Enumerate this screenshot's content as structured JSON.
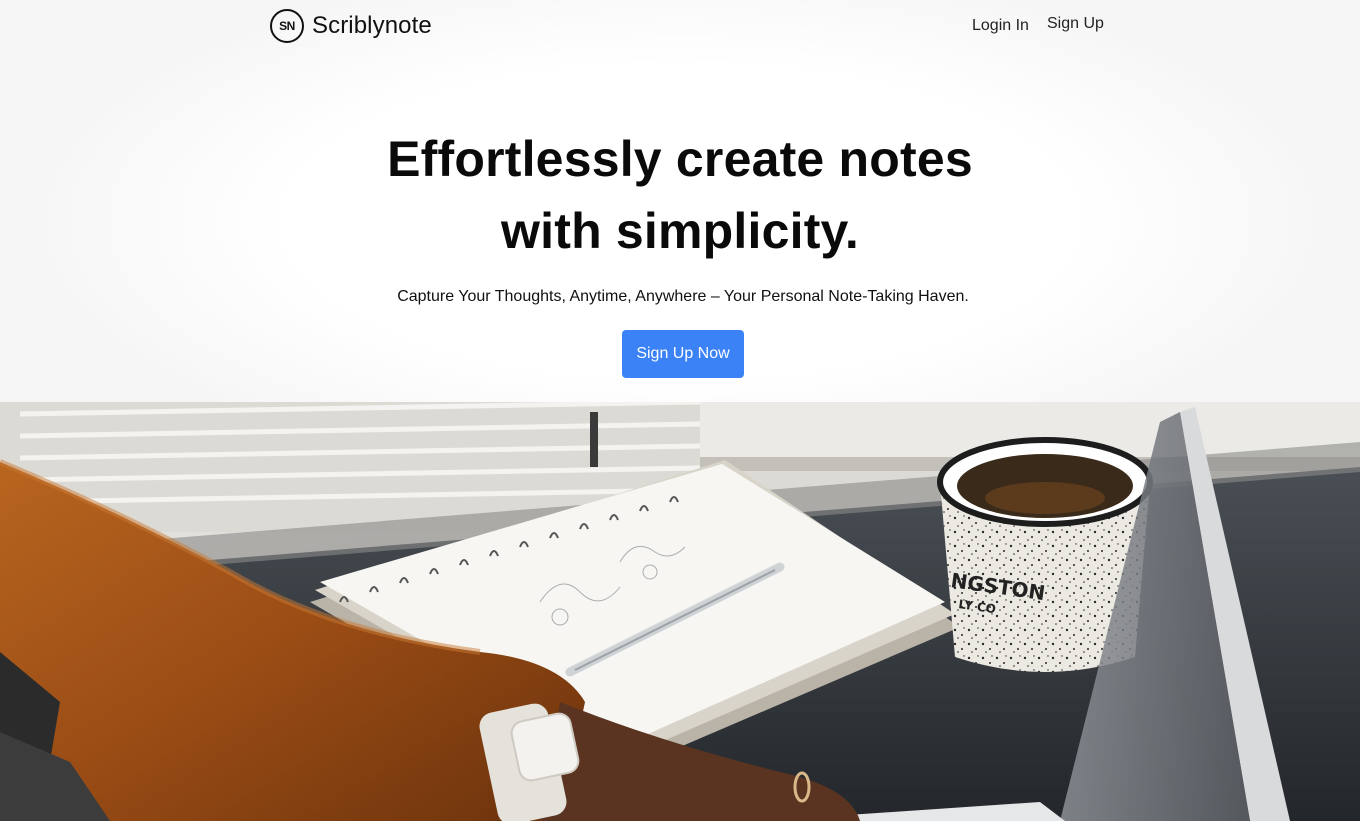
{
  "nav": {
    "logo_initials": "SN",
    "brand_name": "Scriblynote",
    "login_label": "Login In",
    "signup_label": "Sign Up"
  },
  "hero": {
    "title_line1": "Effortlessly create notes",
    "title_line2": "with simplicity.",
    "subtitle": "Capture Your Thoughts, Anytime, Anywhere – Your Personal Note-Taking Haven.",
    "cta_label": "Sign Up Now"
  },
  "image": {
    "mug_text_line1": "NGSTON",
    "mug_text_line2": "LY CO"
  },
  "colors": {
    "accent": "#3b82f6",
    "sweater": "#a8561c",
    "desk": "#2b2f33"
  }
}
